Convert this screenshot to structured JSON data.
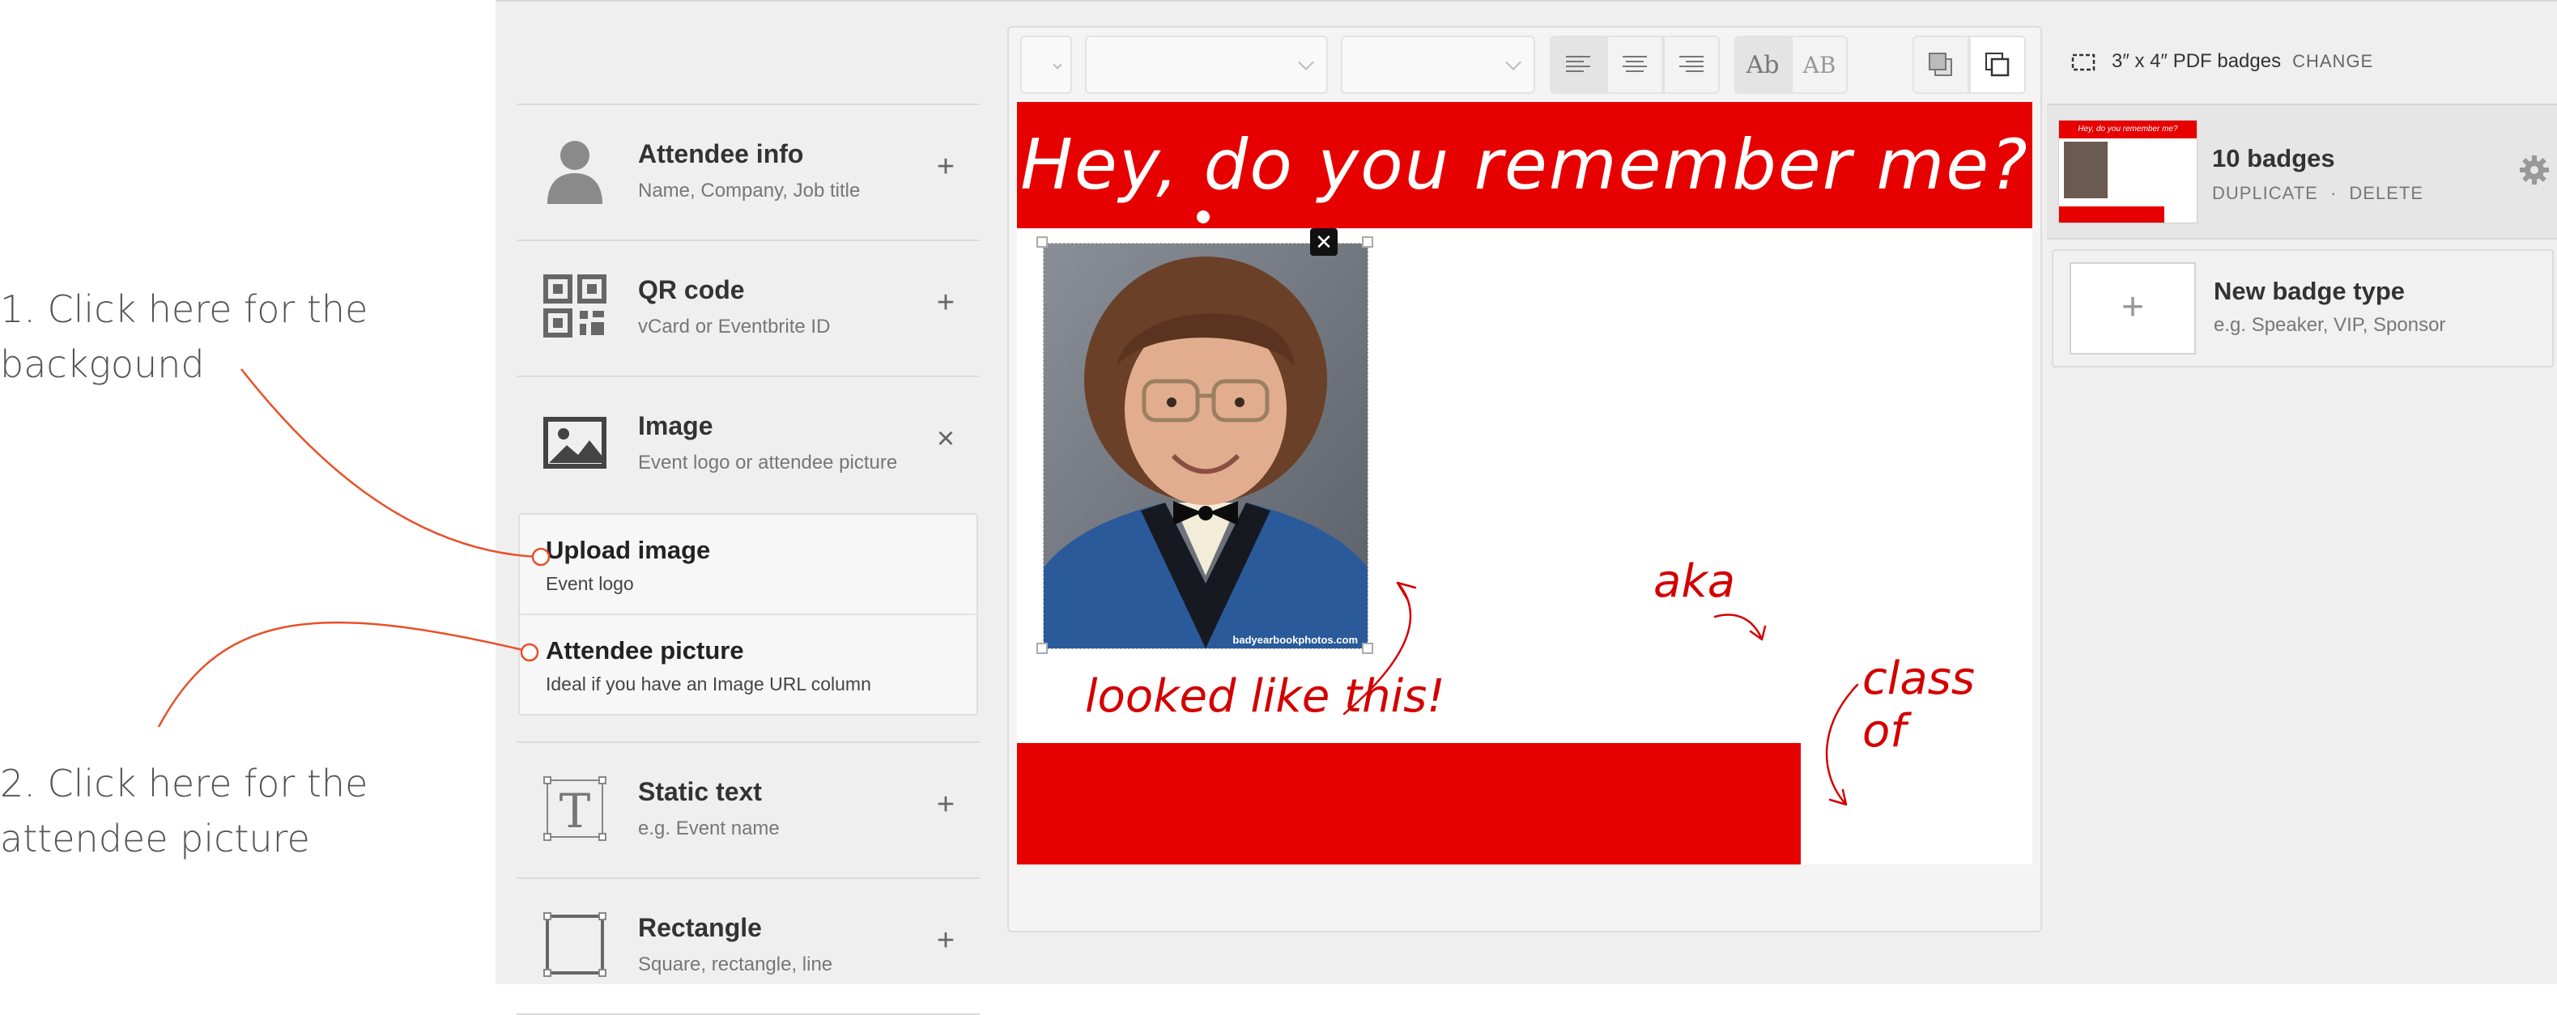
{
  "callouts": {
    "one": "1. Click here for the\nbackgound",
    "two": "2. Click here for the\nattendee picture"
  },
  "elements": [
    {
      "title": "Attendee info",
      "subtitle": "Name, Company, Job title",
      "action": "+"
    },
    {
      "title": "QR code",
      "subtitle": "vCard or Eventbrite ID",
      "action": "+"
    },
    {
      "title": "Image",
      "subtitle": "Event logo or attendee picture",
      "action": "×"
    },
    {
      "title": "Static text",
      "subtitle": "e.g. Event name",
      "action": "+"
    },
    {
      "title": "Rectangle",
      "subtitle": "Square, rectangle, line",
      "action": "+"
    }
  ],
  "image_submenu": [
    {
      "title": "Upload image",
      "desc": "Event logo"
    },
    {
      "title": "Attendee picture",
      "desc": "Ideal if you have an Image URL column"
    }
  ],
  "toolbar": {
    "case_normal": "Ab",
    "case_upper": "AB"
  },
  "badge": {
    "title": "Hey, do you remember me?",
    "hand_aka": "aka",
    "hand_looked": "looked like this!",
    "hand_class": "class of",
    "photo_watermark": "badyearbookphotos.com",
    "primary_color": "#e60000",
    "close_symbol": "✕"
  },
  "sidebar": {
    "size_label": "3″ x 4″ PDF badges",
    "change_label": "CHANGE",
    "badge_type": {
      "title": "10 badges",
      "duplicate": "DUPLICATE",
      "separator": "·",
      "delete": "DELETE"
    },
    "new_type": {
      "plus": "+",
      "title": "New badge type",
      "subtitle": "e.g. Speaker, VIP, Sponsor"
    },
    "thumb_title": "Hey, do you remember me?"
  },
  "icons": [
    "person-icon",
    "qr-icon",
    "image-icon",
    "text-icon",
    "rectangle-icon",
    "gear-icon",
    "crop-icon"
  ]
}
